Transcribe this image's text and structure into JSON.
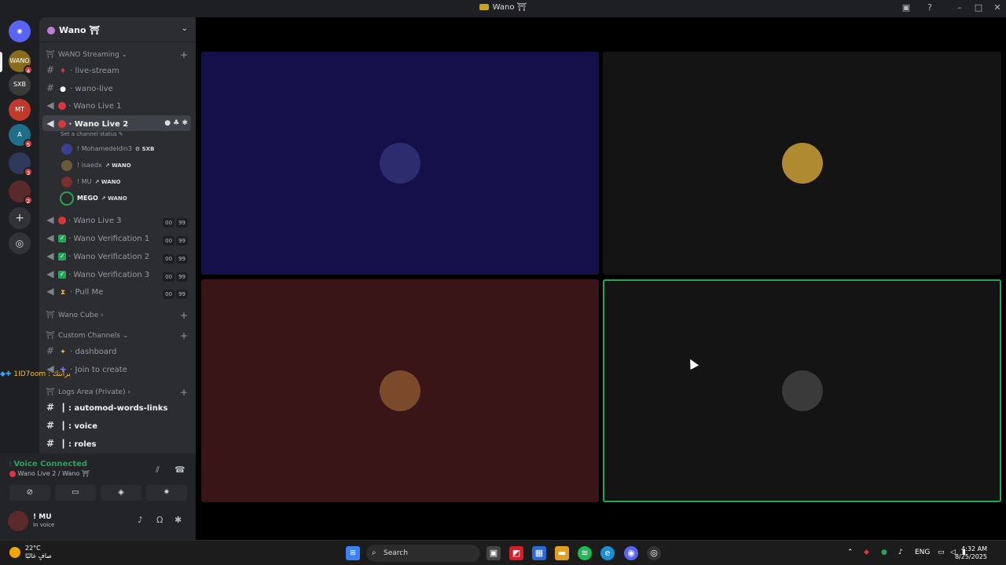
{
  "window": {
    "title": "Wano ⛩"
  },
  "servers": [
    {
      "label": "WANO",
      "color": "#8a6d1a",
      "badge": "4"
    },
    {
      "label": "SXB",
      "color": "#3a3a3a",
      "badge": ""
    },
    {
      "label": "MT",
      "color": "#c0392b",
      "badge": ""
    },
    {
      "label": "A",
      "color": "#1f6f8b",
      "badge": "5"
    },
    {
      "label": "",
      "color": "#2d3a5a",
      "badge": "3"
    },
    {
      "label": "",
      "color": "#5a2a2a",
      "badge": "2"
    }
  ],
  "server_actions": {
    "add": "+",
    "discover": "◎"
  },
  "sidebar": {
    "server_name": "Wano ⛩",
    "cat_streaming": "WANO Streaming",
    "ch_live_stream": "live-stream",
    "ch_wano_live": "wano-live",
    "ch_live1": "Wano Live 1",
    "ch_live2": "Wano Live 2",
    "live2_status": "Set a channel status",
    "members": [
      {
        "name": "! Mohamedeldin3",
        "tag": "SXB",
        "color": "#3b3f8f"
      },
      {
        "name": "! isaedx",
        "tag": "WANO",
        "color": "#6b5a3a"
      },
      {
        "name": "! MU",
        "tag": "WANO",
        "color": "#7a2f2f"
      },
      {
        "name": "MEGO",
        "tag": "WANO",
        "color": "#2a2a2a"
      }
    ],
    "ch_live3": "Wano Live 3",
    "ch_ver1": "Wano Verification 1",
    "ch_ver2": "Wano Verification 2",
    "ch_ver3": "Wano Verification 3",
    "ch_pull": "Pull Me",
    "cnt_a": "00",
    "cnt_b": "99",
    "cat_cube": "Wano Cube",
    "cat_custom": "Custom Channels",
    "ch_dashboard": "dashboard",
    "ch_join": "Join to create",
    "cat_logs": "Logs Area (Private)",
    "ch_automod": "┃ : automod-words-links",
    "ch_voice": "┃ : voice",
    "ch_roles": "┃ : roles"
  },
  "overlay_text": "1ID7oom : برانتك",
  "voice": {
    "status": "Voice Connected",
    "channel": "Wano Live 2 / Wano ⛩"
  },
  "user": {
    "name": "! MU",
    "status": "In voice"
  },
  "tiles": [
    {
      "bg": "#14104a",
      "avatar": "#2c2c6e"
    },
    {
      "bg": "#141414",
      "avatar": "#b08a30"
    },
    {
      "bg": "#3a1518",
      "avatar": "#7a4a2a"
    },
    {
      "bg": "#141414",
      "avatar": "#3a3a3a",
      "speaking": true
    }
  ],
  "taskbar": {
    "temp": "22°C",
    "weather": "صافٍ غالبًا",
    "search": "Search",
    "lang": "ENG",
    "time": "4:32 AM",
    "date": "8/25/2025"
  }
}
